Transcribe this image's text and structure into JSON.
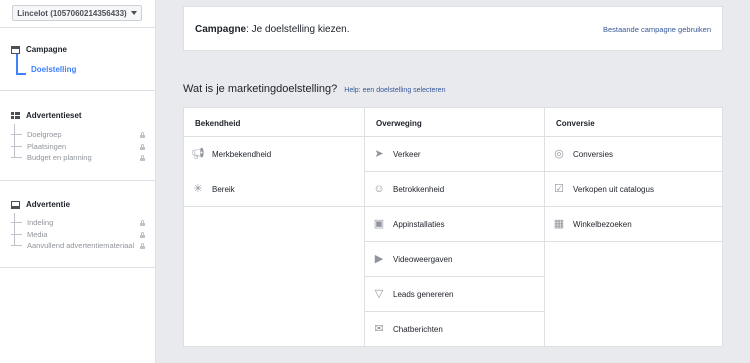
{
  "account": {
    "label": "Lincelot (1057060214356433)"
  },
  "sidebar": {
    "campaign": {
      "title": "Campagne",
      "items": [
        {
          "label": "Doelstelling"
        }
      ]
    },
    "adset": {
      "title": "Advertentieset",
      "items": [
        {
          "label": "Doelgroep"
        },
        {
          "label": "Plaatsingen"
        },
        {
          "label": "Budget en planning"
        }
      ]
    },
    "ad": {
      "title": "Advertentie",
      "items": [
        {
          "label": "Indeling"
        },
        {
          "label": "Media"
        },
        {
          "label": "Aanvullend advertentiemateriaal"
        }
      ]
    }
  },
  "campaign_card": {
    "prefix": "Campagne",
    "text": ": Je doelstelling kiezen.",
    "link": "Bestaande campagne gebruiken"
  },
  "objective": {
    "heading": "Wat is je marketingdoelstelling?",
    "help": "Help: een doelstelling selecteren"
  },
  "columns": [
    {
      "title": "Bekendheid",
      "items": [
        {
          "label": "Merkbekendheid",
          "icon": "megaphone-icon"
        },
        {
          "label": "Bereik",
          "icon": "reach-icon"
        }
      ]
    },
    {
      "title": "Overweging",
      "items": [
        {
          "label": "Verkeer",
          "icon": "cursor-icon"
        },
        {
          "label": "Betrokkenheid",
          "icon": "people-icon"
        },
        {
          "label": "Appinstallaties",
          "icon": "box-icon"
        },
        {
          "label": "Videoweergaven",
          "icon": "video-icon"
        },
        {
          "label": "Leads genereren",
          "icon": "funnel-icon"
        },
        {
          "label": "Chatberichten",
          "icon": "chat-icon"
        }
      ]
    },
    {
      "title": "Conversie",
      "items": [
        {
          "label": "Conversies",
          "icon": "globe-icon"
        },
        {
          "label": "Verkopen uit catalogus",
          "icon": "cart-icon"
        },
        {
          "label": "Winkelbezoeken",
          "icon": "store-icon"
        }
      ]
    }
  ]
}
